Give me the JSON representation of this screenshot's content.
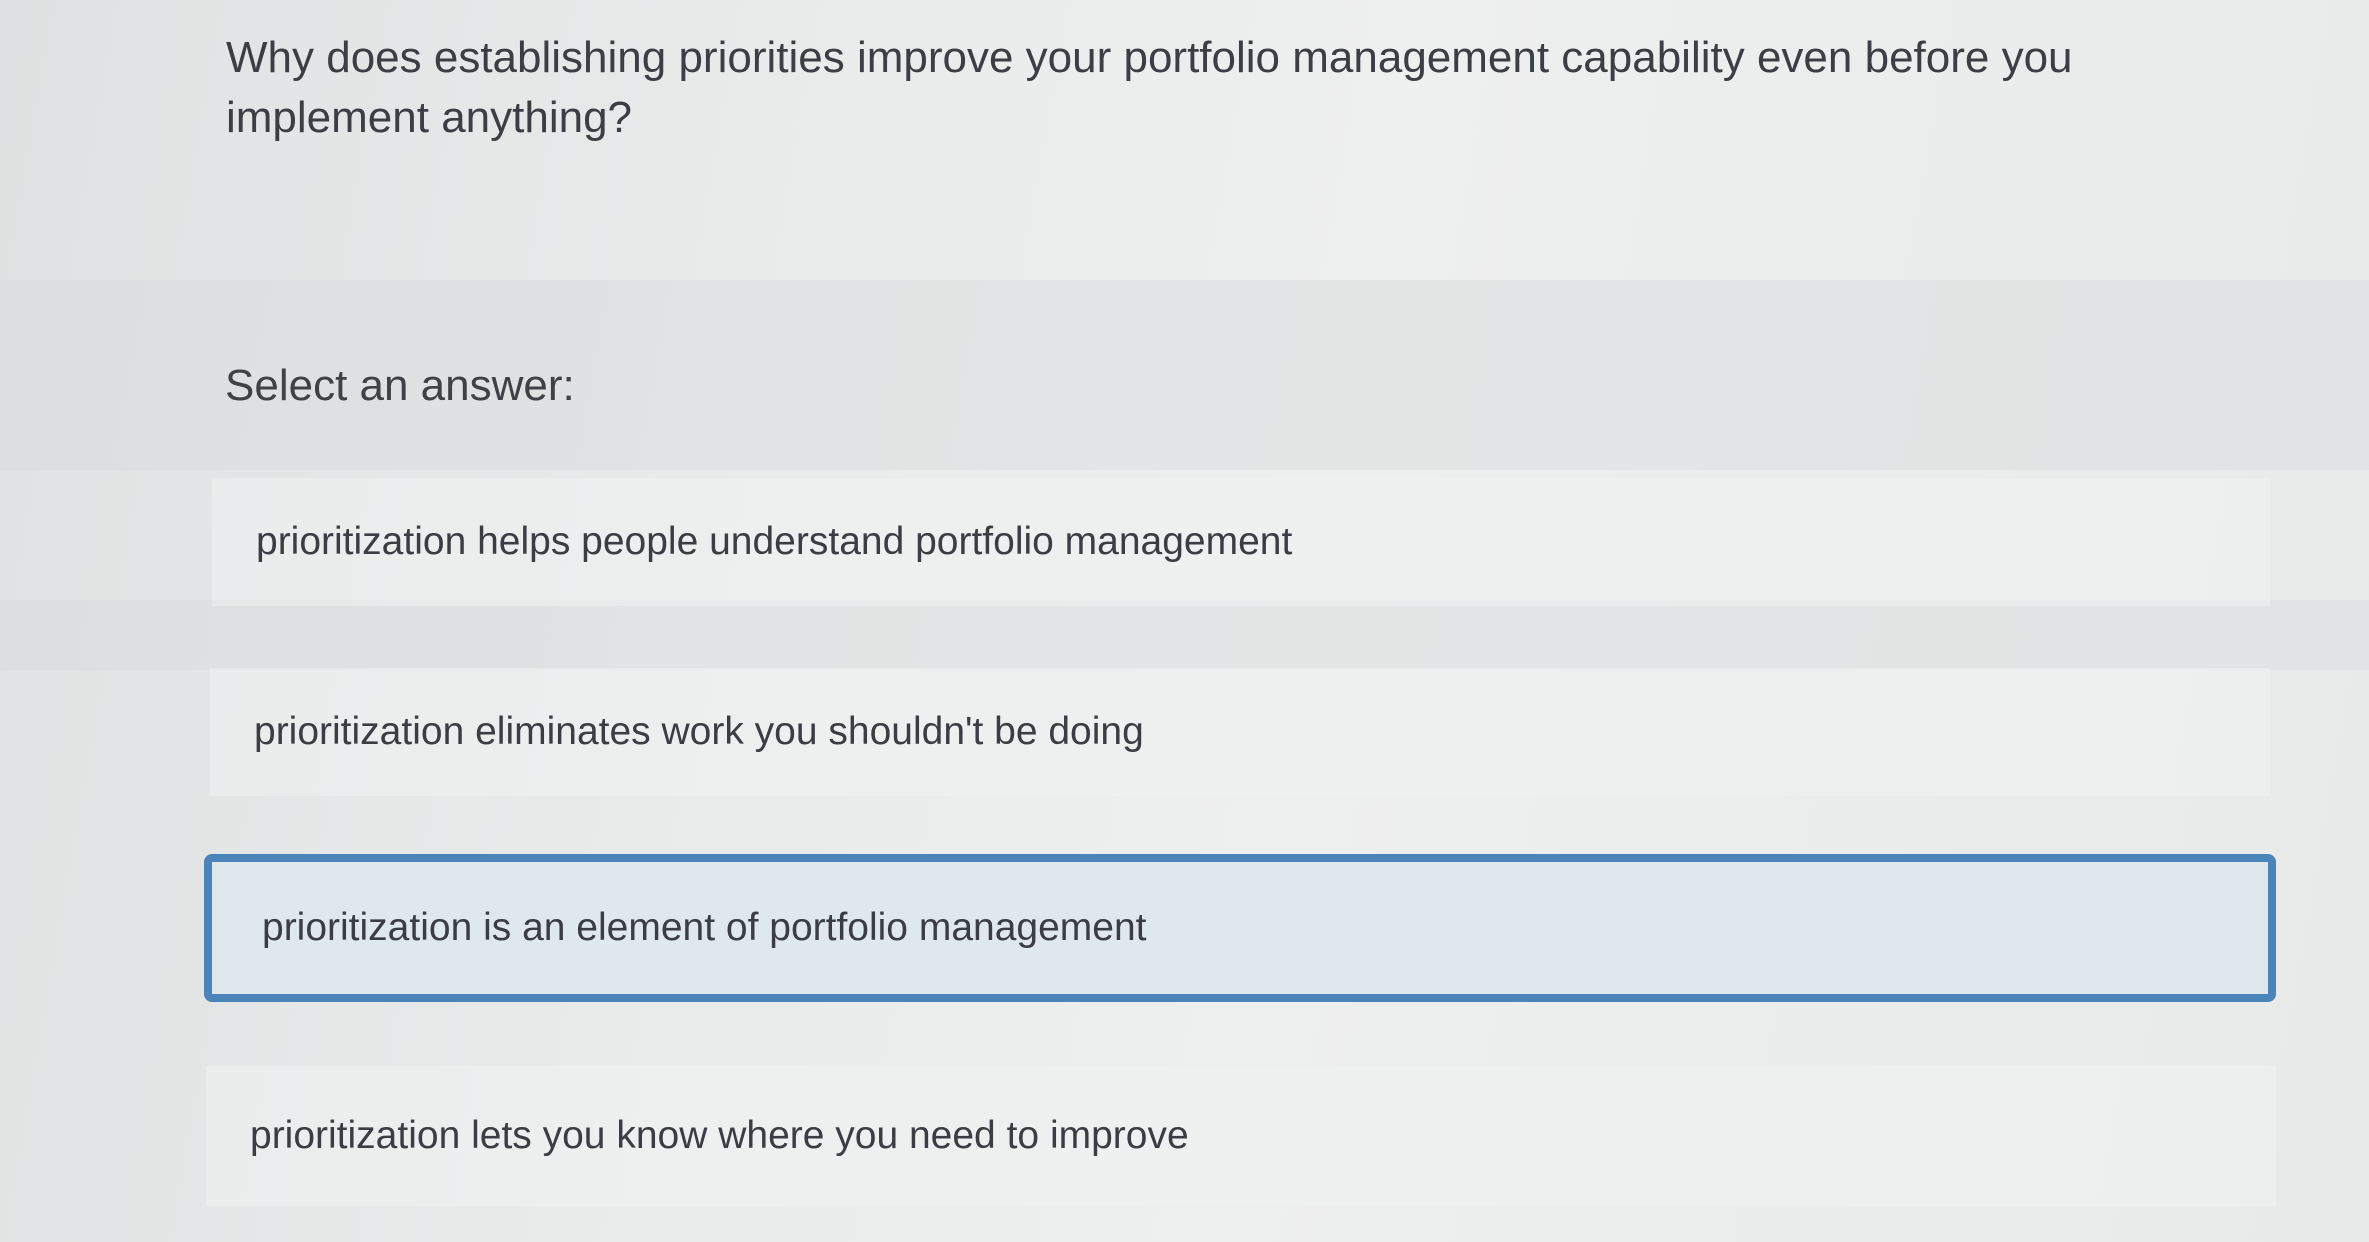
{
  "question": {
    "text": "Why does establishing priorities improve your portfolio management capability even before you implement anything?"
  },
  "answer_prompt": "Select an answer:",
  "options": [
    {
      "label": "prioritization helps people understand portfolio management",
      "selected": false
    },
    {
      "label": "prioritization eliminates work you shouldn't be doing",
      "selected": false
    },
    {
      "label": "prioritization is an element of portfolio management",
      "selected": true
    },
    {
      "label": "prioritization lets you know where you need to improve",
      "selected": false
    }
  ],
  "colors": {
    "selected_border": "#4a84b8",
    "selected_background": "#dfe8ec",
    "text": "#3a3e42"
  }
}
